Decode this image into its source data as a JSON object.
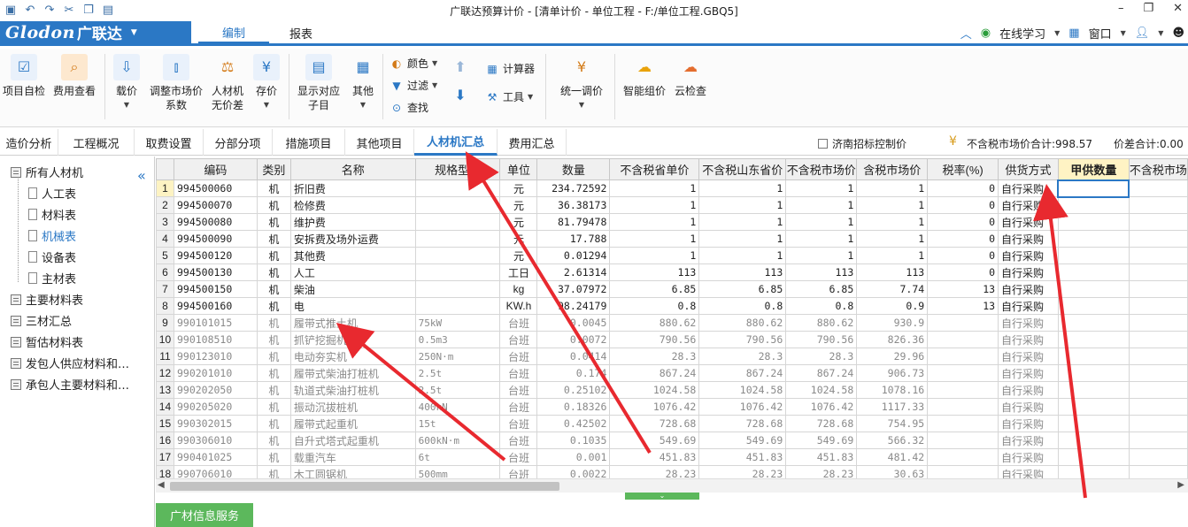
{
  "window": {
    "title": "广联达预算计价 - [清单计价 - 单位工程 - F:/单位工程.GBQ5]"
  },
  "brand": {
    "logo": "Glodon",
    "name": "广联达"
  },
  "main_tabs": [
    {
      "label": "编制",
      "active": true
    },
    {
      "label": "报表",
      "active": false
    }
  ],
  "top_right": {
    "online_learning": "在线学习",
    "window_menu": "窗口"
  },
  "ribbon": {
    "project_check": "项目自检",
    "fee_view": "费用查看",
    "price_load": "载价",
    "adjust_coef_line1": "调整市场价",
    "adjust_coef_line2": "系数",
    "labor_line1": "人材机",
    "labor_line2": "无价差",
    "save_price": "存价",
    "show_sub_line1": "显示对应",
    "show_sub_line2": "子目",
    "other": "其他",
    "color": "颜色",
    "filter": "过滤",
    "find": "查找",
    "calculator": "计算器",
    "tools": "工具",
    "uniform_adjust": "统一调价",
    "smart_price": "智能组价",
    "cloud_check": "云检查"
  },
  "func_tabs": [
    {
      "label": "造价分析",
      "active": false
    },
    {
      "label": "工程概况",
      "active": false
    },
    {
      "label": "取费设置",
      "active": false
    },
    {
      "label": "分部分项",
      "active": false
    },
    {
      "label": "措施项目",
      "active": false
    },
    {
      "label": "其他项目",
      "active": false
    },
    {
      "label": "人材机汇总",
      "active": true
    },
    {
      "label": "费用汇总",
      "active": false
    }
  ],
  "control_price_label": "济南招标控制价",
  "totals": {
    "market_total": "不含税市场价合计:998.57",
    "diff_total": "价差合计:0.00"
  },
  "sidebar": {
    "items": [
      {
        "label": "所有人材机",
        "selected": false
      },
      {
        "label": "人工表",
        "selected": false
      },
      {
        "label": "材料表",
        "selected": false
      },
      {
        "label": "机械表",
        "selected": true
      },
      {
        "label": "设备表",
        "selected": false
      },
      {
        "label": "主材表",
        "selected": false
      },
      {
        "label": "主要材料表",
        "selected": false
      },
      {
        "label": "三材汇总",
        "selected": false
      },
      {
        "label": "暂估材料表",
        "selected": false
      },
      {
        "label": "发包人供应材料和…",
        "selected": false
      },
      {
        "label": "承包人主要材料和…",
        "selected": false
      }
    ],
    "info_service": "广材信息服务"
  },
  "table": {
    "headers": [
      "",
      "编码",
      "类别",
      "名称",
      "规格型号",
      "单位",
      "数量",
      "不含税省单价",
      "不含税山东省价",
      "不含税市场价",
      "含税市场价",
      "税率(%)",
      "供货方式",
      "甲供数量",
      "不含税市场"
    ],
    "rows": [
      [
        "1",
        "994500060",
        "机",
        "折旧费",
        "",
        "元",
        "234.72592",
        "1",
        "1",
        "1",
        "1",
        "0",
        "自行采购"
      ],
      [
        "2",
        "994500070",
        "机",
        "检修费",
        "",
        "元",
        "36.38173",
        "1",
        "1",
        "1",
        "1",
        "0",
        "自行采购"
      ],
      [
        "3",
        "994500080",
        "机",
        "维护费",
        "",
        "元",
        "81.79478",
        "1",
        "1",
        "1",
        "1",
        "0",
        "自行采购"
      ],
      [
        "4",
        "994500090",
        "机",
        "安拆费及场外运费",
        "",
        "元",
        "17.788",
        "1",
        "1",
        "1",
        "1",
        "0",
        "自行采购"
      ],
      [
        "5",
        "994500120",
        "机",
        "其他费",
        "",
        "元",
        "0.01294",
        "1",
        "1",
        "1",
        "1",
        "0",
        "自行采购"
      ],
      [
        "6",
        "994500130",
        "机",
        "人工",
        "",
        "工日",
        "2.61314",
        "113",
        "113",
        "113",
        "113",
        "0",
        "自行采购"
      ],
      [
        "7",
        "994500150",
        "机",
        "柴油",
        "",
        "kg",
        "37.07972",
        "6.85",
        "6.85",
        "6.85",
        "7.74",
        "13",
        "自行采购"
      ],
      [
        "8",
        "994500160",
        "机",
        "电",
        "",
        "KW.h",
        "98.24179",
        "0.8",
        "0.8",
        "0.8",
        "0.9",
        "13",
        "自行采购"
      ],
      [
        "9",
        "990101015",
        "机",
        "履带式推土机",
        "75kW",
        "台班",
        "0.0045",
        "880.62",
        "880.62",
        "880.62",
        "930.9",
        "",
        "自行采购"
      ],
      [
        "10",
        "990108510",
        "机",
        "抓铲挖掘机",
        "0.5m3",
        "台班",
        "0.0072",
        "790.56",
        "790.56",
        "790.56",
        "826.36",
        "",
        "自行采购"
      ],
      [
        "11",
        "990123010",
        "机",
        "电动夯实机",
        "250N·m",
        "台班",
        "0.0414",
        "28.3",
        "28.3",
        "28.3",
        "29.96",
        "",
        "自行采购"
      ],
      [
        "12",
        "990201010",
        "机",
        "履带式柴油打桩机",
        "2.5t",
        "台班",
        "0.174",
        "867.24",
        "867.24",
        "867.24",
        "906.73",
        "",
        "自行采购"
      ],
      [
        "13",
        "990202050",
        "机",
        "轨道式柴油打桩机",
        "2.5t",
        "台班",
        "0.25102",
        "1024.58",
        "1024.58",
        "1024.58",
        "1078.16",
        "",
        "自行采购"
      ],
      [
        "14",
        "990205020",
        "机",
        "振动沉拔桩机",
        "400kN",
        "台班",
        "0.18326",
        "1076.42",
        "1076.42",
        "1076.42",
        "1117.33",
        "",
        "自行采购"
      ],
      [
        "15",
        "990302015",
        "机",
        "履带式起重机",
        "15t",
        "台班",
        "0.42502",
        "728.68",
        "728.68",
        "728.68",
        "754.95",
        "",
        "自行采购"
      ],
      [
        "16",
        "990306010",
        "机",
        "自升式塔式起重机",
        "600kN·m",
        "台班",
        "0.1035",
        "549.69",
        "549.69",
        "549.69",
        "566.32",
        "",
        "自行采购"
      ],
      [
        "17",
        "990401025",
        "机",
        "载重汽车",
        "6t",
        "台班",
        "0.001",
        "451.83",
        "451.83",
        "451.83",
        "481.42",
        "",
        "自行采购"
      ],
      [
        "18",
        "990706010",
        "机",
        "木工圆锯机",
        "500mm",
        "台班",
        "0.0022",
        "28.23",
        "28.23",
        "28.23",
        "30.63",
        "",
        "自行采购"
      ]
    ]
  },
  "colors": {
    "accent": "#2b78c5",
    "annotation": "#e8292f",
    "green": "#5cb85c"
  }
}
